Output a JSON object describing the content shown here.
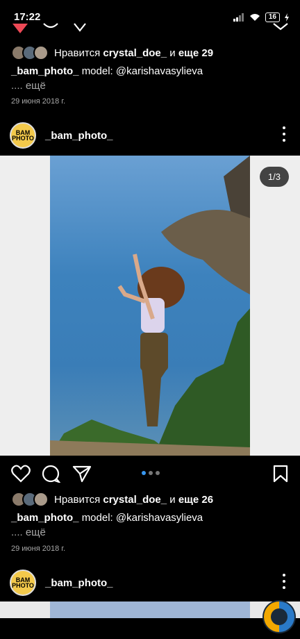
{
  "status": {
    "time": "17:22",
    "battery": "16"
  },
  "top_post": {
    "likes_prefix": "Нравится",
    "likes_user": "crystal_doe_",
    "likes_middle": "и",
    "likes_rest": "еще 29",
    "caption_user": "_bam_photo_",
    "caption_text": "model: @karishavasylieva",
    "more": ".... ещё",
    "date": "29 июня 2018 г."
  },
  "post": {
    "username": "_bam_photo_",
    "avatar_text": "BAM PHOTO",
    "counter": "1/3",
    "carousel": {
      "total": 3,
      "active": 1
    },
    "likes_prefix": "Нравится",
    "likes_user": "crystal_doe_",
    "likes_middle": "и",
    "likes_rest": "еще 26",
    "caption_user": "_bam_photo_",
    "caption_text": "model: @karishavasylieva",
    "more": ".... ещё",
    "date": "29 июня 2018 г."
  },
  "next_post": {
    "username": "_bam_photo_",
    "avatar_text": "BAM PHOTO"
  },
  "colors": {
    "accent": "#3897f0",
    "like_red": "#ed4956",
    "background": "#000000"
  }
}
